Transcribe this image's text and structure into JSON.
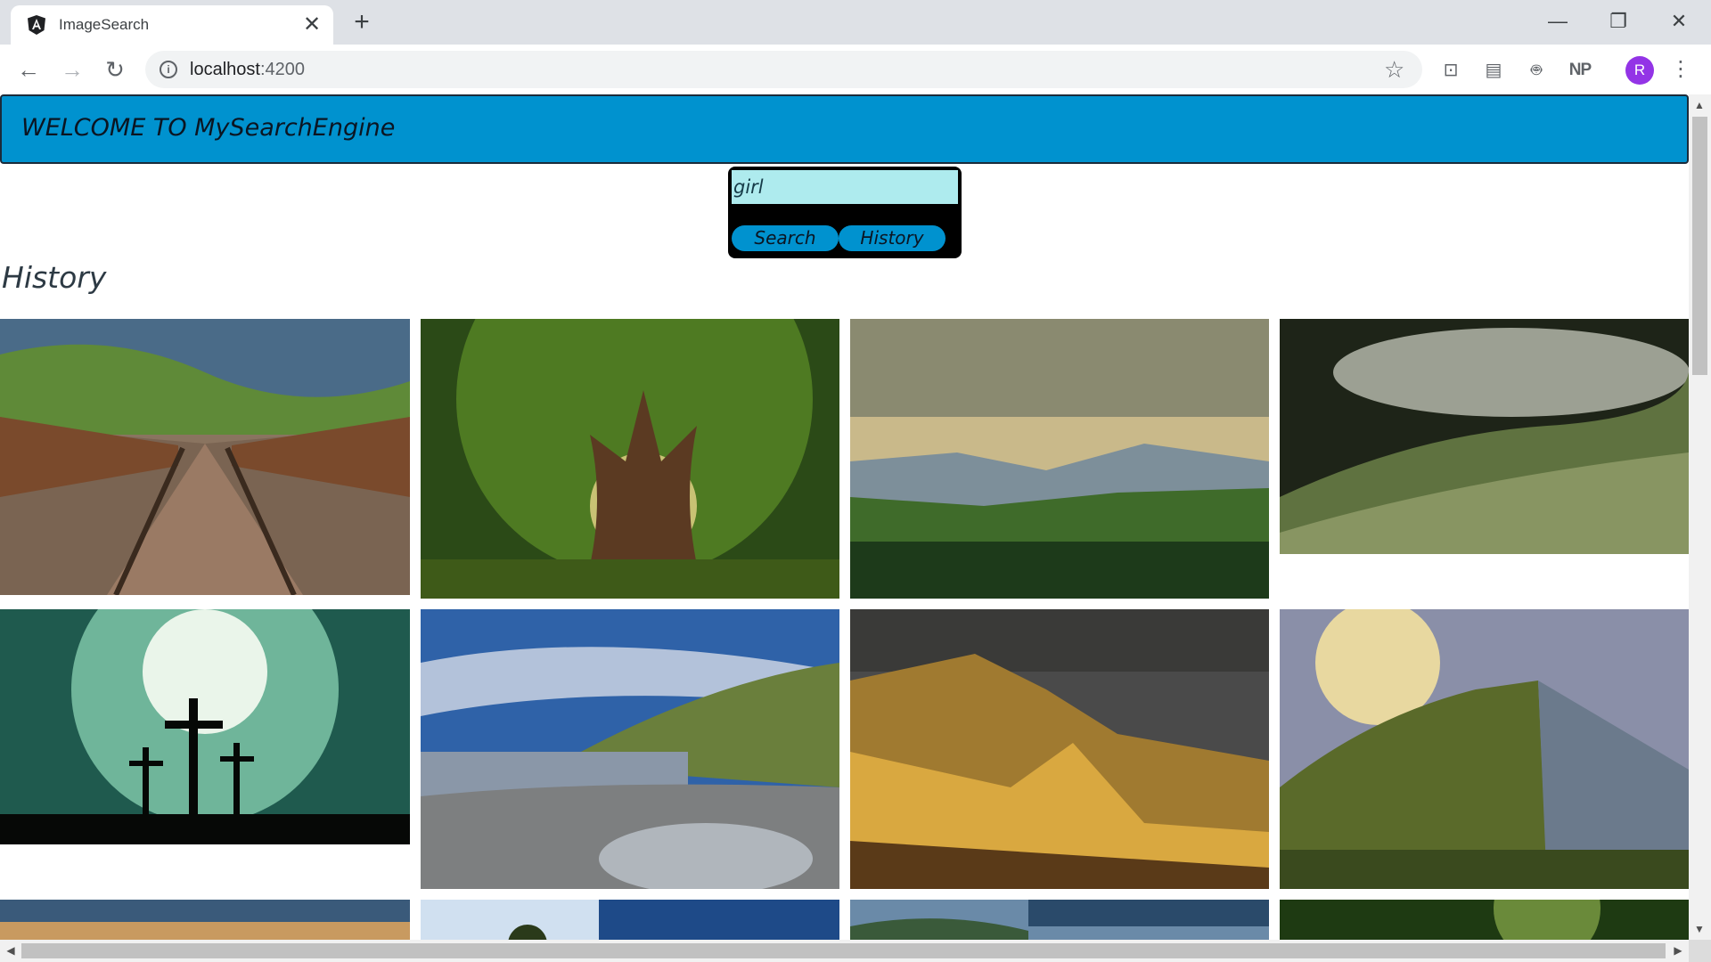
{
  "browser": {
    "tab_title": "ImageSearch",
    "tab_close": "✕",
    "new_tab": "+",
    "url_host": "localhost",
    "url_port": ":4200",
    "window_controls": {
      "minimize": "—",
      "maximize": "❐",
      "close": "✕"
    },
    "avatar_letter": "R",
    "extension_np": "NP"
  },
  "page": {
    "header_title": "WELCOME TO MySearchEngine",
    "search": {
      "value": "girl",
      "placeholder": ""
    },
    "buttons": {
      "search": "Search",
      "history": "History"
    },
    "section_heading": "History"
  },
  "gallery": {
    "images": [
      {
        "subject": "railway-bridge",
        "colors": [
          "#4a6b88",
          "#6b8a3c",
          "#7a5238",
          "#9a7a64"
        ]
      },
      {
        "subject": "ancient-tree",
        "colors": [
          "#2b4a17",
          "#6e8f2a",
          "#e8d58a",
          "#5b3a22"
        ]
      },
      {
        "subject": "mountain-valley",
        "colors": [
          "#c9b98a",
          "#7d8f9a",
          "#3f6b2a",
          "#1d3a1a"
        ]
      },
      {
        "subject": "misty-hills",
        "colors": [
          "#1e2418",
          "#5f7240",
          "#a3ad7a",
          "#d2d6c8"
        ]
      },
      {
        "subject": "three-crosses",
        "colors": [
          "#eaf5ea",
          "#6fb59a",
          "#1f5a4e",
          "#060806"
        ]
      },
      {
        "subject": "rocky-coast",
        "colors": [
          "#2f62a8",
          "#d4dbe6",
          "#6a7f3c",
          "#8a97a8"
        ]
      },
      {
        "subject": "golden-cliffs",
        "colors": [
          "#4a4a4a",
          "#a07a30",
          "#d9a840",
          "#5a3a18"
        ]
      },
      {
        "subject": "sunset-cliff",
        "colors": [
          "#8a8fa8",
          "#e8d8a0",
          "#5a6a2a",
          "#3a4a1e"
        ]
      },
      {
        "subject": "dusk-sky",
        "colors": [
          "#3a5a7a",
          "#c89a60"
        ]
      },
      {
        "subject": "blue-sky-tree",
        "colors": [
          "#1e4a88",
          "#d0e0f0"
        ]
      },
      {
        "subject": "cloudy-hills",
        "colors": [
          "#2a4a6a",
          "#6a8aa8"
        ]
      },
      {
        "subject": "green-canopy",
        "colors": [
          "#1e3a12",
          "#6a8a3a"
        ]
      }
    ]
  }
}
